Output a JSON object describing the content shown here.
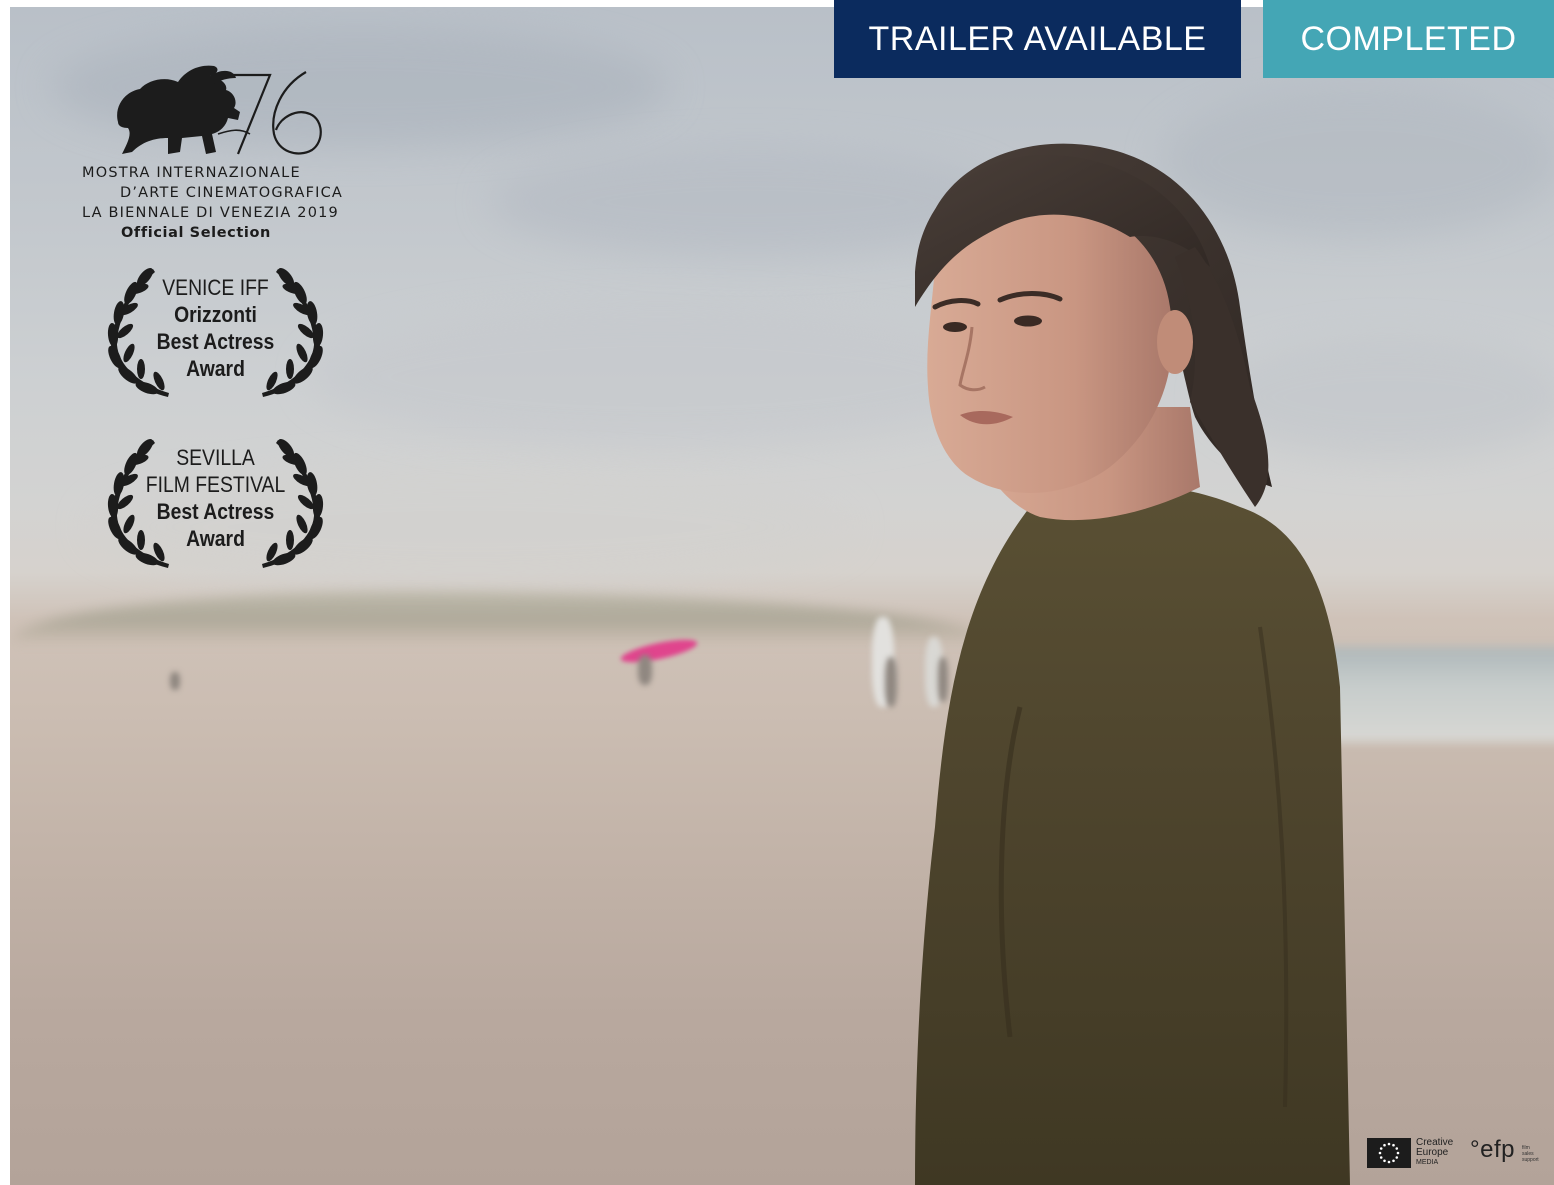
{
  "tags": {
    "trailer": "TRAILER AVAILABLE",
    "completed": "COMPLETED"
  },
  "colors": {
    "trailer_bg": "#0b2b5e",
    "completed_bg": "#44a6b5"
  },
  "venice": {
    "number": "76",
    "line1": "MOSTRA INTERNAZIONALE",
    "line2": "D’ARTE CINEMATOGRAFICA",
    "line3": "LA BIENNALE DI VENEZIA 2019",
    "line4": "Official Selection"
  },
  "laurels": [
    {
      "lines": [
        {
          "text": "VENICE IFF",
          "bold": false
        },
        {
          "text": "Orizzonti",
          "bold": true
        },
        {
          "text": "Best Actress",
          "bold": true
        },
        {
          "text": "Award",
          "bold": true
        }
      ]
    },
    {
      "lines": [
        {
          "text": "SEVILLA",
          "bold": false
        },
        {
          "text": "FILM FESTIVAL",
          "bold": false
        },
        {
          "text": "Best Actress",
          "bold": true
        },
        {
          "text": "Award",
          "bold": true
        }
      ]
    }
  ],
  "footer": {
    "creative_europe": {
      "line1": "Creative",
      "line2": "Europe",
      "line3": "MEDIA"
    },
    "efp": {
      "main": "°efp",
      "sub1": "film",
      "sub2": "sales",
      "sub3": "support"
    }
  },
  "icons": {
    "venice_logo": "winged-lion-icon",
    "laurel": "laurel-wreath-icon",
    "eu_flag": "eu-stars-icon"
  }
}
